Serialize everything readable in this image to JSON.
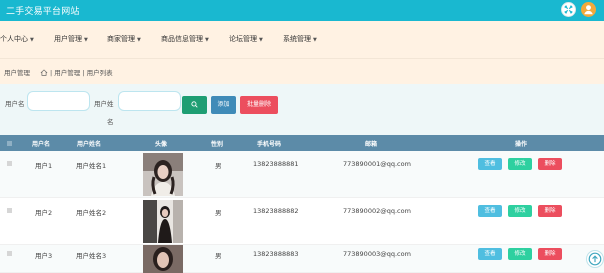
{
  "app": {
    "title": "二手交易平台网站"
  },
  "topbar": {
    "expand_icon": "expand-icon",
    "avatar_icon": "user-avatar-icon",
    "avatar_color": "#f2a93b",
    "bar_color": "#19b8d0"
  },
  "nav": [
    {
      "label": "个人中心"
    },
    {
      "label": "用户管理"
    },
    {
      "label": "商家管理"
    },
    {
      "label": "商品信息管理"
    },
    {
      "label": "论坛管理"
    },
    {
      "label": "系统管理"
    }
  ],
  "breadcrumb": {
    "title": "用户管理",
    "path": "| 用户管理 | 用户列表",
    "home_icon": "home-icon"
  },
  "search": {
    "username_label": "用户名",
    "username_value": "",
    "name_label_line1": "用户姓",
    "name_label_line2": "名",
    "name_value": "",
    "search_icon": "search-icon",
    "add_label": "添加",
    "batch_delete_label": "批量删除"
  },
  "table": {
    "columns": [
      "用户名",
      "用户姓名",
      "头像",
      "性别",
      "手机号码",
      "邮箱",
      "操作"
    ],
    "rows": [
      {
        "username": "用户1",
        "name": "用户姓名1",
        "gender": "男",
        "phone": "13823888881",
        "email": "773890001@qq.com"
      },
      {
        "username": "用户2",
        "name": "用户姓名2",
        "gender": "男",
        "phone": "13823888882",
        "email": "773890002@qq.com"
      },
      {
        "username": "用户3",
        "name": "用户姓名3",
        "gender": "男",
        "phone": "13823888883",
        "email": "773890003@qq.com"
      }
    ],
    "actions": {
      "view": "查看",
      "edit": "修改",
      "delete": "删除"
    }
  },
  "scroll_top_icon": "arrow-up-icon"
}
